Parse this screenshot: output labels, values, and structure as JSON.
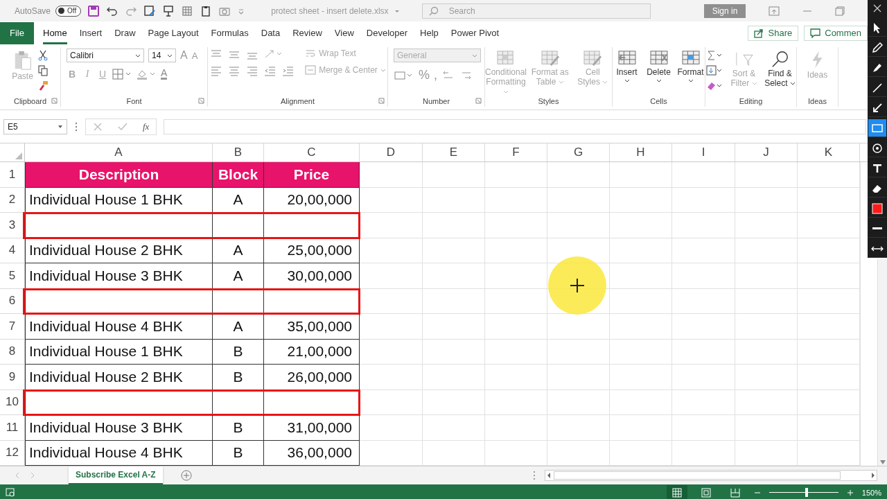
{
  "title_bar": {
    "autosave_label": "AutoSave",
    "autosave_on": false,
    "autosave_state": "Off",
    "file_name": "protect sheet - insert delete.xlsx",
    "search_placeholder": "Search",
    "sign_in": "Sign in"
  },
  "menu_tabs": [
    {
      "label": "File",
      "kind": "file",
      "selected": false
    },
    {
      "label": "Home",
      "kind": "tab",
      "selected": true
    },
    {
      "label": "Insert",
      "kind": "tab",
      "selected": false
    },
    {
      "label": "Draw",
      "kind": "tab",
      "selected": false
    },
    {
      "label": "Page Layout",
      "kind": "tab",
      "selected": false
    },
    {
      "label": "Formulas",
      "kind": "tab",
      "selected": false
    },
    {
      "label": "Data",
      "kind": "tab",
      "selected": false
    },
    {
      "label": "Review",
      "kind": "tab",
      "selected": false
    },
    {
      "label": "View",
      "kind": "tab",
      "selected": false
    },
    {
      "label": "Developer",
      "kind": "tab",
      "selected": false
    },
    {
      "label": "Help",
      "kind": "tab",
      "selected": false
    },
    {
      "label": "Power Pivot",
      "kind": "tab",
      "selected": false
    }
  ],
  "share": "Share",
  "comments": "Commen",
  "ribbon": {
    "clipboard": {
      "label": "Clipboard",
      "paste": {
        "label": "Paste",
        "disabled": true
      }
    },
    "font": {
      "label": "Font",
      "font_name": "Calibri",
      "font_size": "14",
      "grow": "A",
      "shrink": "A",
      "bold": {
        "label": "B",
        "disabled": true
      },
      "italic": {
        "label": "I",
        "disabled": true
      },
      "underline": {
        "label": "U",
        "disabled": true
      },
      "font_color": "A"
    },
    "alignment": {
      "label": "Alignment",
      "wrap_text": {
        "label": "Wrap Text",
        "disabled": true
      },
      "merge_center": {
        "label": "Merge & Center",
        "disabled": true
      }
    },
    "number": {
      "label": "Number",
      "format": {
        "value": "General",
        "disabled": true
      },
      "percent": "%",
      "comma": ","
    },
    "styles": {
      "label": "Styles",
      "commands": [
        {
          "label": "Conditional Formatting",
          "disabled": true
        },
        {
          "label": "Format as Table",
          "disabled": true
        },
        {
          "label": "Cell Styles",
          "disabled": true
        }
      ]
    },
    "cells": {
      "label": "Cells",
      "commands": [
        {
          "label": "Insert",
          "disabled": false
        },
        {
          "label": "Delete",
          "disabled": false
        },
        {
          "label": "Format",
          "disabled": false
        }
      ]
    },
    "editing": {
      "label": "Editing",
      "commands": [
        {
          "label": "Sort & Filter",
          "disabled": true
        },
        {
          "label": "Find & Select",
          "disabled": false
        }
      ]
    },
    "ideas": {
      "label": "Ideas",
      "commands": [
        {
          "label": "Ideas",
          "disabled": true
        }
      ]
    }
  },
  "formula_bar": {
    "name_box": "E5",
    "fx": "fx"
  },
  "columns": [
    "A",
    "B",
    "C",
    "D",
    "E",
    "F",
    "G",
    "H",
    "I",
    "J",
    "K"
  ],
  "rows": [
    {
      "number": "1",
      "kind": "header",
      "cells": [
        "Description",
        "Block",
        "Price"
      ],
      "highlighted": false
    },
    {
      "number": "2",
      "kind": "data",
      "cells": [
        "Individual House 1 BHK",
        "A",
        "20,00,000"
      ],
      "highlighted": false
    },
    {
      "number": "3",
      "kind": "data",
      "cells": [],
      "highlighted": true
    },
    {
      "number": "4",
      "kind": "data",
      "cells": [
        "Individual House 2 BHK",
        "A",
        "25,00,000"
      ],
      "highlighted": false
    },
    {
      "number": "5",
      "kind": "data",
      "cells": [
        "Individual House 3 BHK",
        "A",
        "30,00,000"
      ],
      "highlighted": false
    },
    {
      "number": "6",
      "kind": "data",
      "cells": [],
      "highlighted": true
    },
    {
      "number": "7",
      "kind": "data",
      "cells": [
        "Individual House 4 BHK",
        "A",
        "35,00,000"
      ],
      "highlighted": false
    },
    {
      "number": "8",
      "kind": "data",
      "cells": [
        "Individual House 1 BHK",
        "B",
        "21,00,000"
      ],
      "highlighted": false
    },
    {
      "number": "9",
      "kind": "data",
      "cells": [
        "Individual House 2 BHK",
        "B",
        "26,00,000"
      ],
      "highlighted": false
    },
    {
      "number": "10",
      "kind": "data",
      "cells": [],
      "highlighted": true
    },
    {
      "number": "11",
      "kind": "data",
      "cells": [
        "Individual House 3 BHK",
        "B",
        "31,00,000"
      ],
      "highlighted": false
    },
    {
      "number": "12",
      "kind": "data",
      "cells": [
        "Individual House 4 BHK",
        "B",
        "36,00,000"
      ],
      "highlighted": false
    }
  ],
  "sheet_tabs": [
    {
      "label": "Subscribe Excel A-Z",
      "selected": true
    }
  ],
  "status_bar": {
    "views": [
      {
        "kind": "normal",
        "selected": true
      },
      {
        "kind": "page-layout",
        "selected": false
      },
      {
        "kind": "page-break",
        "selected": false
      }
    ],
    "zoom": {
      "level": 0.54,
      "reading": "150%"
    }
  },
  "annotation_tools": [
    {
      "kind": "cursor",
      "selected": false
    },
    {
      "kind": "pen",
      "selected": false
    },
    {
      "kind": "highlighter",
      "selected": false
    },
    {
      "kind": "line",
      "selected": false
    },
    {
      "kind": "arrow",
      "selected": false
    },
    {
      "kind": "rectangle",
      "selected": true
    },
    {
      "kind": "stamp",
      "selected": false
    },
    {
      "kind": "text",
      "selected": false
    },
    {
      "kind": "eraser",
      "selected": false
    },
    {
      "kind": "color",
      "selected": false
    },
    {
      "kind": "weight",
      "selected": false
    },
    {
      "kind": "expand",
      "selected": false
    }
  ]
}
